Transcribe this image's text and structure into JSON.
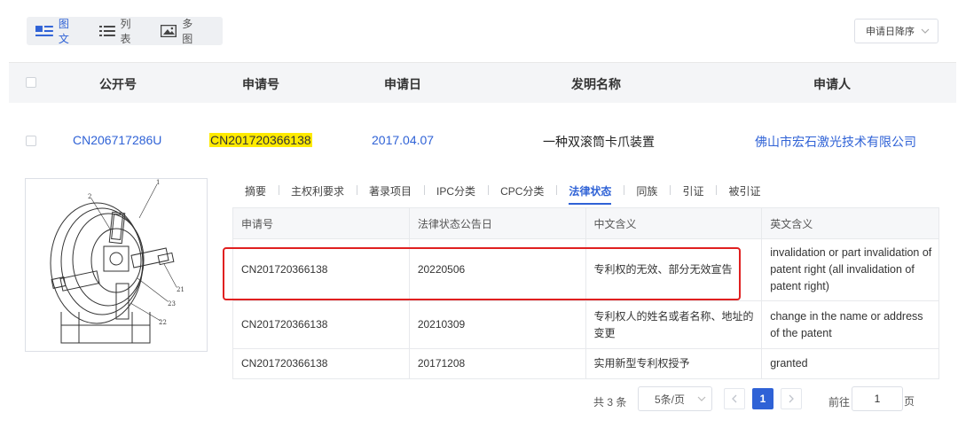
{
  "view_toggle": {
    "options": [
      {
        "label": "图文",
        "icon": "image-text-icon",
        "active": true
      },
      {
        "label": "列表",
        "icon": "list-icon",
        "active": false
      },
      {
        "label": "多图",
        "icon": "gallery-icon",
        "active": false
      }
    ]
  },
  "sort": {
    "selected": "申请日降序"
  },
  "columns": {
    "pub_no": "公开号",
    "app_no": "申请号",
    "app_date": "申请日",
    "title": "发明名称",
    "applicant": "申请人"
  },
  "result": {
    "pub_no": "CN206717286U",
    "app_no": "CN201720366138",
    "app_date": "2017.04.07",
    "title": "一种双滚筒卡爪装置",
    "applicant": "佛山市宏石激光技术有限公司"
  },
  "drawing_labels": [
    "1",
    "2",
    "21",
    "22",
    "23"
  ],
  "tabs": [
    "摘要",
    "主权利要求",
    "著录项目",
    "IPC分类",
    "CPC分类",
    "法律状态",
    "同族",
    "引证",
    "被引证"
  ],
  "active_tab": "法律状态",
  "legal_table": {
    "headers": [
      "申请号",
      "法律状态公告日",
      "中文含义",
      "英文含义"
    ],
    "rows": [
      [
        "CN201720366138",
        "20220506",
        "专利权的无效、部分无效宣告",
        "invalidation or part invalidation of patent right (all invalidation of patent right)"
      ],
      [
        "CN201720366138",
        "20210309",
        "专利权人的姓名或者名称、地址的变更",
        "change in the name or address of the patent"
      ],
      [
        "CN201720366138",
        "20171208",
        "实用新型专利权授予",
        "granted"
      ]
    ]
  },
  "pagination": {
    "total": "共 3 条",
    "page_size": "5条/页",
    "current_page": "1",
    "goto_label": "前往",
    "goto_value": "1",
    "page_unit": "页"
  },
  "colors": {
    "accent": "#2f62d6",
    "highlight": "#ffea00",
    "annotation_box": "#e02020"
  }
}
